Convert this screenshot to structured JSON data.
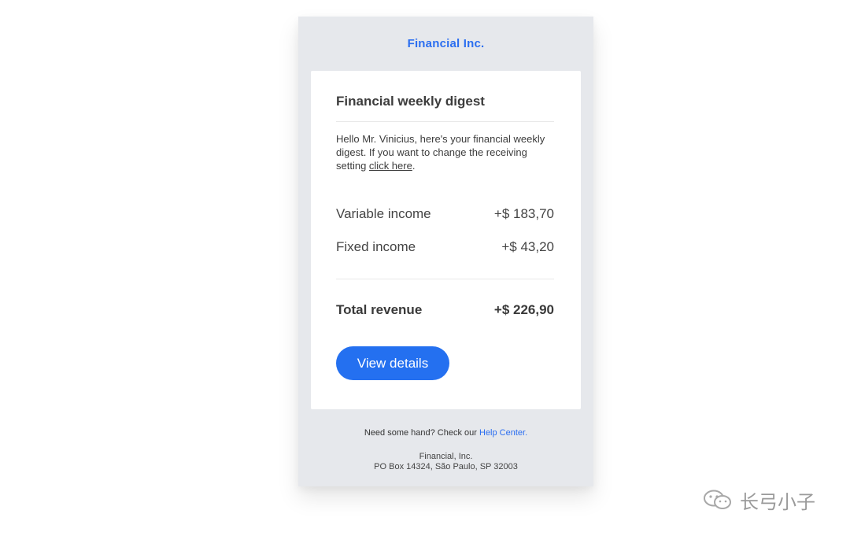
{
  "header": {
    "brand": "Financial Inc."
  },
  "card": {
    "title": "Financial weekly digest",
    "greeting": {
      "text": "Hello Mr. Vinicius, here's your financial weekly digest. If you want to change the receiving setting ",
      "link": "click here",
      "suffix": "."
    },
    "rows": [
      {
        "label": "Variable income",
        "value": "+$ 183,70"
      },
      {
        "label": "Fixed income",
        "value": "+$ 43,20"
      }
    ],
    "total": {
      "label": "Total revenue",
      "value": "+$ 226,90"
    },
    "button_label": "View details"
  },
  "footer": {
    "help_text": "Need some hand? Check our ",
    "help_link": "Help Center.",
    "company": "Financial, Inc.",
    "address": "PO Box 14324, São Paulo, SP 32003"
  },
  "watermark": {
    "icon": "wechat-icon",
    "text": "长弓小子"
  },
  "colors": {
    "accent": "#2470f0",
    "brand_text": "#2b6ef0",
    "email_background": "#e6e8ec",
    "card_background": "#ffffff"
  }
}
